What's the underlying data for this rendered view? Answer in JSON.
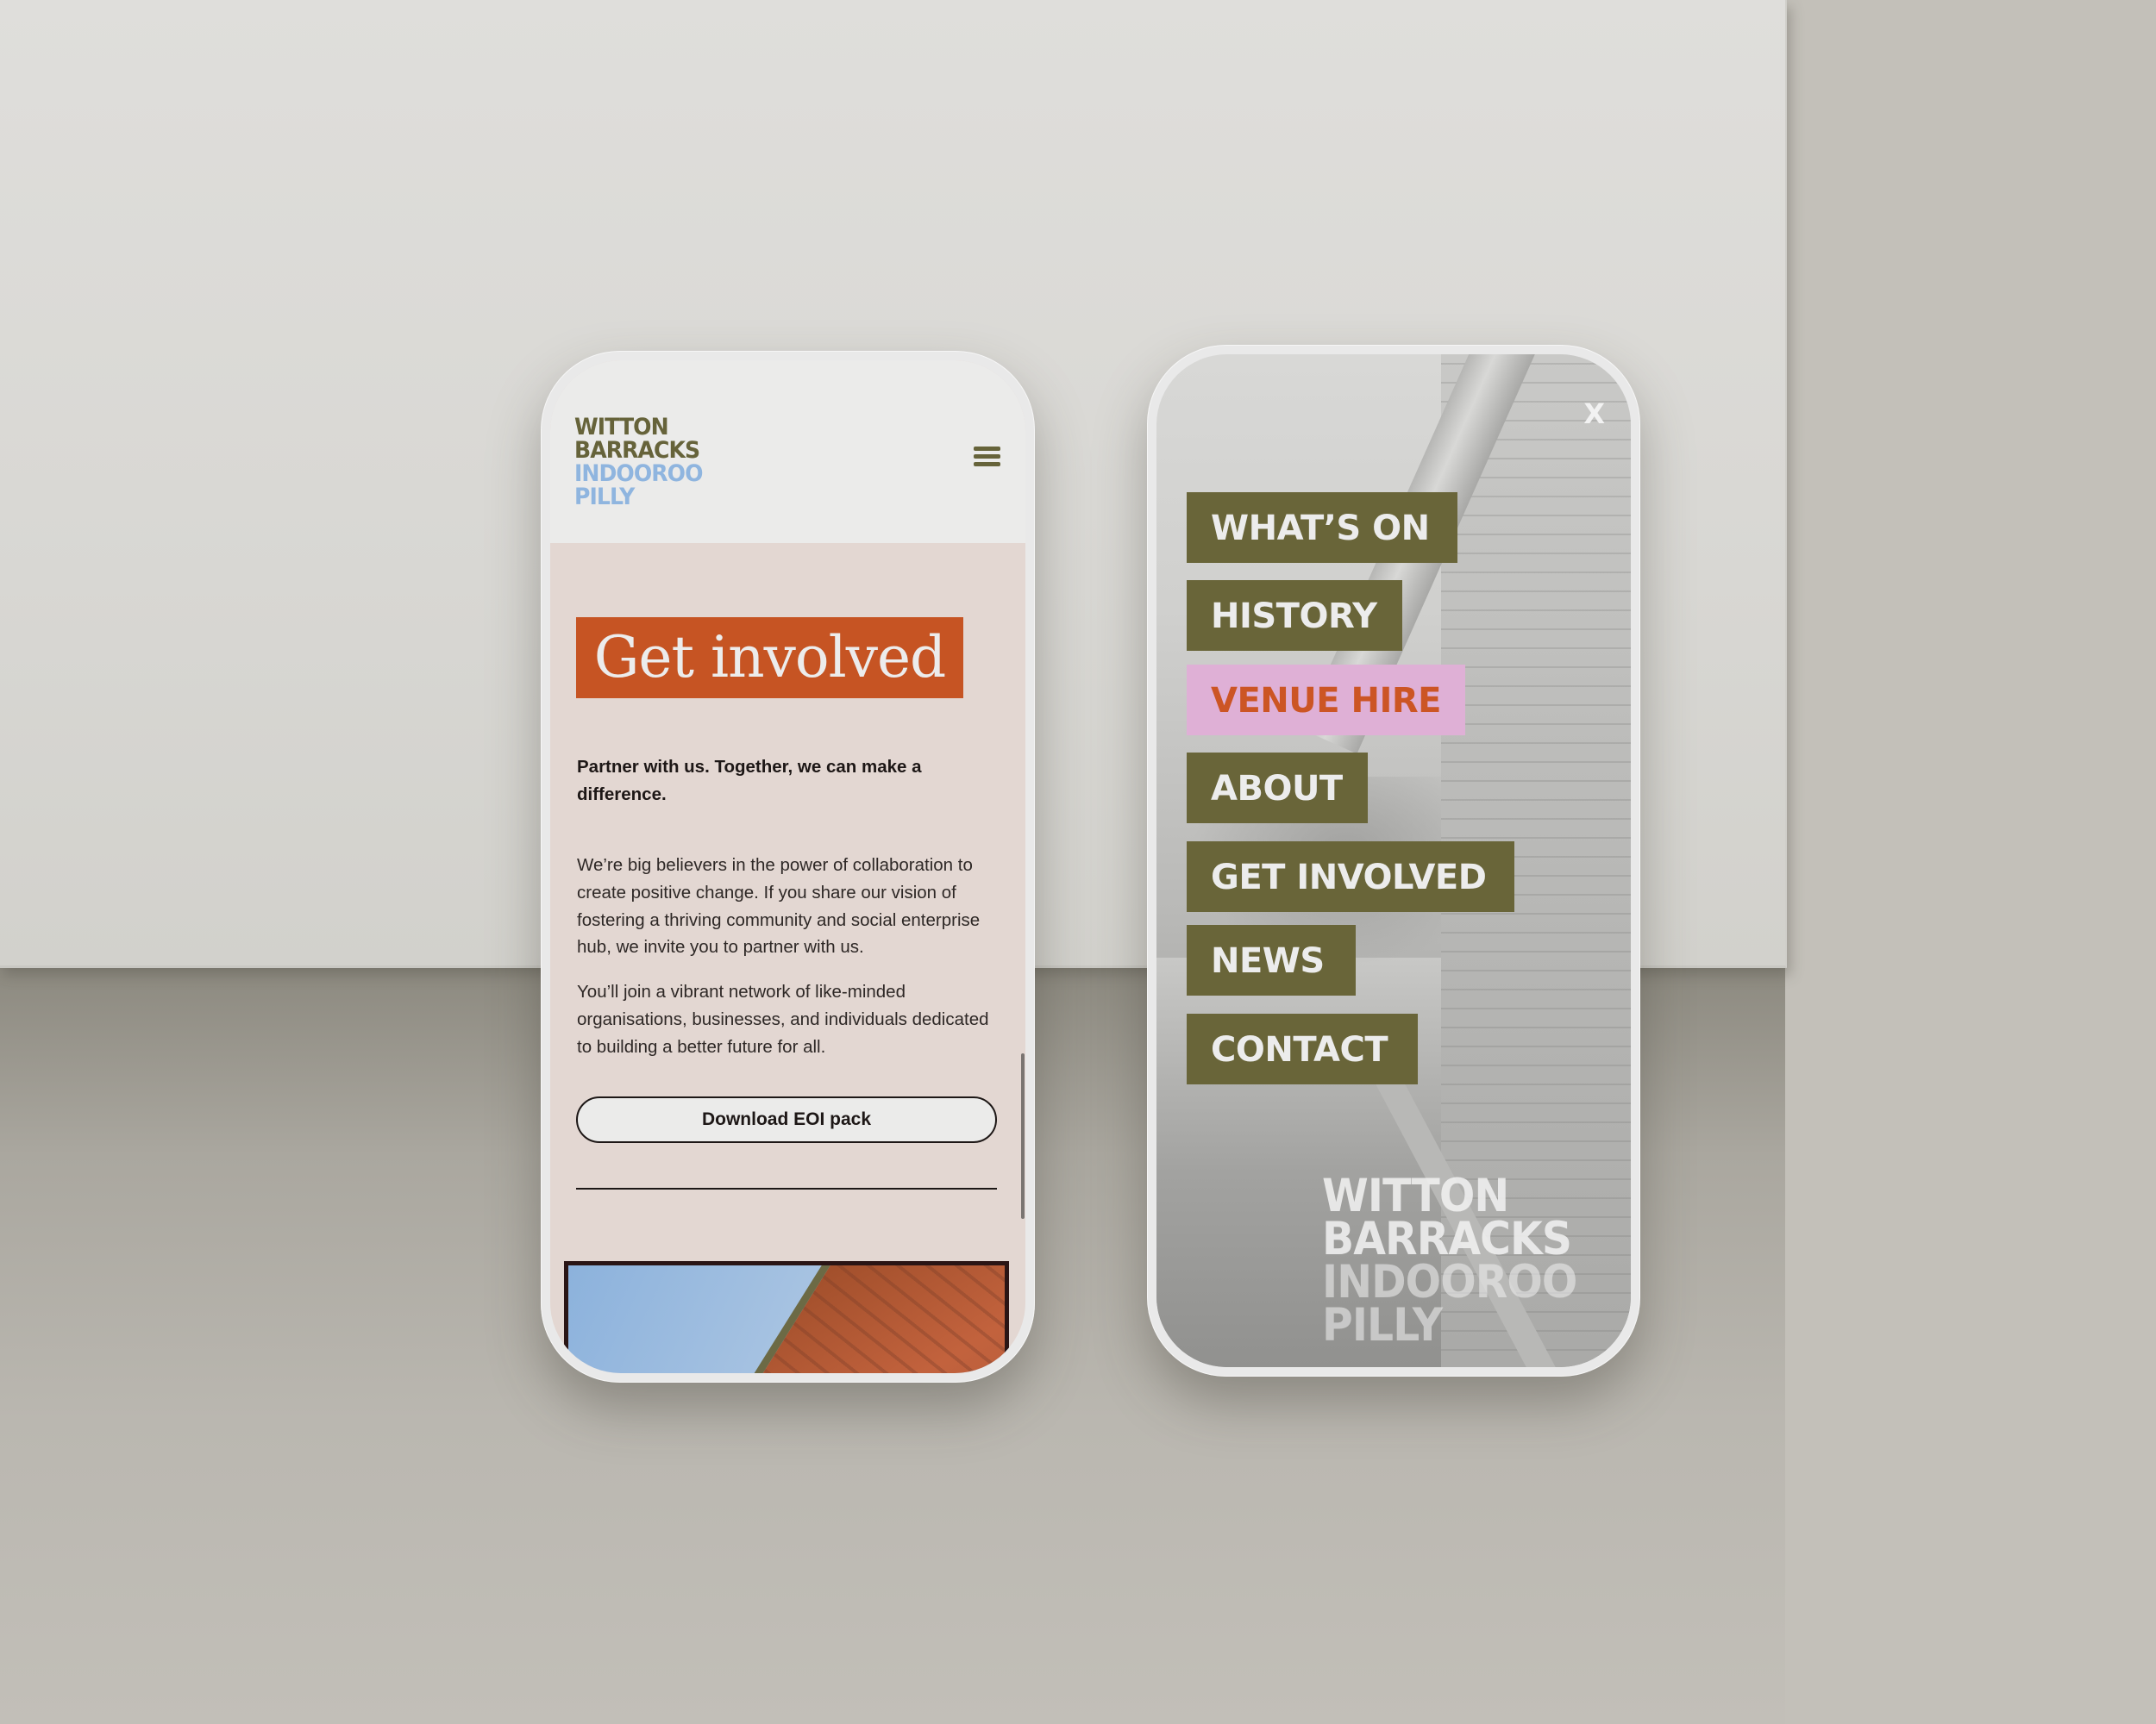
{
  "scene": {
    "colors": {
      "olive": "#696539",
      "blue": "#8fb5df",
      "orange": "#c65423",
      "pink": "#dfb0d6",
      "blush_background": "#e3d7d2"
    }
  },
  "left_phone": {
    "logo": {
      "line1": "WITTON",
      "line2": "BARRACKS",
      "line3": "INDOOROO",
      "line4": "PILLY"
    },
    "menu_icon": "hamburger-icon",
    "hero_title": "Get involved",
    "lead": "Partner with us. Together, we can make a difference.",
    "paragraphs": [
      "We’re big believers in the power of collaboration to create positive change. If you share our vision of fostering a thriving community and social enterprise hub, we invite you to partner with us.",
      "You’ll join a vibrant network of like-minded organisations, businesses, and individuals dedicated to building a better future for all."
    ],
    "button_label": "Download EOI pack"
  },
  "right_phone": {
    "close_label": "X",
    "menu_items": [
      {
        "label": "WHAT’S ON",
        "active": false
      },
      {
        "label": "HISTORY",
        "active": false
      },
      {
        "label": "VENUE HIRE",
        "active": true
      },
      {
        "label": "ABOUT",
        "active": false
      },
      {
        "label": "GET INVOLVED",
        "active": false
      },
      {
        "label": "NEWS",
        "active": false
      },
      {
        "label": "CONTACT",
        "active": false
      }
    ],
    "logo": {
      "line1": "WITTON",
      "line2": "BARRACKS",
      "line3": "INDOOROO",
      "line4": "PILLY"
    }
  }
}
